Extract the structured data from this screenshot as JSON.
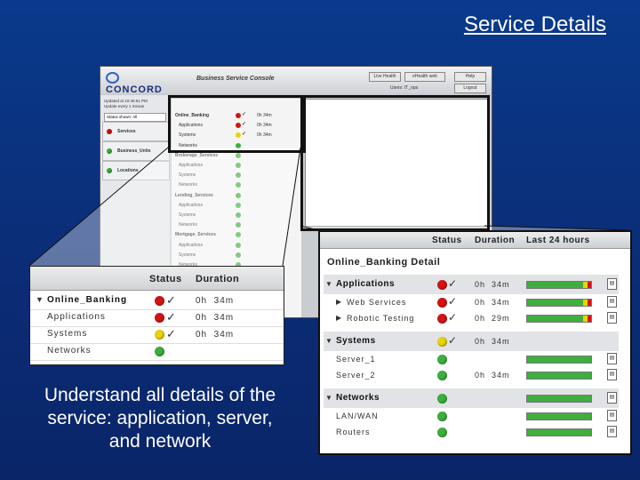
{
  "slide": {
    "title": "Service Details",
    "caption": "Understand all details of the service: application, server, and network"
  },
  "console": {
    "logo_text": "CONCORD",
    "app_title": "Business Service Console",
    "top_buttons": [
      "Live Health",
      "eHealth web",
      "Help"
    ],
    "user_label": "Users: IT_ops",
    "logout_label": "Logout",
    "side_info": [
      "Updated at 10:46:51 PM",
      "Update every 1 minute"
    ],
    "status_select": "Status shown: All",
    "side_items": [
      {
        "label": "Services",
        "status": "red"
      },
      {
        "label": "Business_Units",
        "status": "green"
      },
      {
        "label": "Locations",
        "status": "green"
      }
    ],
    "tree": [
      {
        "label": "Online_Banking",
        "head": true,
        "status": "red",
        "check": true,
        "duration": "0h 34m"
      },
      {
        "label": "Applications",
        "status": "red",
        "check": true,
        "duration": "0h 34m"
      },
      {
        "label": "Systems",
        "status": "yellow",
        "check": true,
        "duration": "0h 34m"
      },
      {
        "label": "Networks",
        "status": "green",
        "check": false,
        "duration": ""
      },
      {
        "label": "Brokerage_Services",
        "head": true,
        "status": "green",
        "check": false,
        "duration": ""
      },
      {
        "label": "Applications",
        "status": "green",
        "check": false,
        "duration": ""
      },
      {
        "label": "Systems",
        "status": "green",
        "check": false,
        "duration": ""
      },
      {
        "label": "Networks",
        "status": "green",
        "check": false,
        "duration": ""
      },
      {
        "label": "Lending_Services",
        "head": true,
        "status": "green",
        "check": false,
        "duration": ""
      },
      {
        "label": "Applications",
        "status": "green",
        "check": false,
        "duration": ""
      },
      {
        "label": "Systems",
        "status": "green",
        "check": false,
        "duration": ""
      },
      {
        "label": "Networks",
        "status": "green",
        "check": false,
        "duration": ""
      },
      {
        "label": "Mortgage_Services",
        "head": true,
        "status": "green",
        "check": false,
        "duration": ""
      },
      {
        "label": "Applications",
        "status": "green",
        "check": false,
        "duration": ""
      },
      {
        "label": "Systems",
        "status": "green",
        "check": false,
        "duration": ""
      },
      {
        "label": "Networks",
        "status": "green",
        "check": false,
        "duration": ""
      }
    ]
  },
  "left_zoom": {
    "col_status": "Status",
    "col_duration": "Duration",
    "rows": [
      {
        "label": "Online_Banking",
        "head": true,
        "status": "red",
        "check": true,
        "duration": "0h  34m"
      },
      {
        "label": "Applications",
        "status": "red",
        "check": true,
        "duration": "0h  34m"
      },
      {
        "label": "Systems",
        "status": "yellow",
        "check": true,
        "duration": "0h  34m"
      },
      {
        "label": "Networks",
        "status": "green",
        "check": false,
        "duration": ""
      }
    ]
  },
  "right_zoom": {
    "col_status": "Status",
    "col_duration": "Duration",
    "col_last24": "Last 24 hours",
    "detail_title": "Online_Banking Detail",
    "sections": [
      {
        "label": "Applications",
        "status": "red",
        "check": true,
        "duration": "0h  34m",
        "bar": "error",
        "items": [
          {
            "label": "Web Services",
            "expand": true,
            "status": "red",
            "check": true,
            "duration": "0h  34m",
            "bar": "error"
          },
          {
            "label": "Robotic Testing",
            "expand": true,
            "status": "red",
            "check": true,
            "duration": "0h  29m",
            "bar": "error"
          }
        ]
      },
      {
        "label": "Systems",
        "status": "yellow",
        "check": true,
        "duration": "0h  34m",
        "bar": "none",
        "items": [
          {
            "label": "Server_1",
            "status": "green",
            "check": false,
            "duration": "",
            "bar": "ok"
          },
          {
            "label": "Server_2",
            "status": "green",
            "check": false,
            "duration": "0h  34m",
            "bar": "ok"
          }
        ]
      },
      {
        "label": "Networks",
        "status": "green",
        "check": false,
        "duration": "",
        "bar": "ok",
        "items": [
          {
            "label": "LAN/WAN",
            "status": "green",
            "check": false,
            "duration": "",
            "bar": "ok"
          },
          {
            "label": "Routers",
            "status": "green",
            "check": false,
            "duration": "",
            "bar": "ok"
          }
        ]
      }
    ]
  },
  "colors": {
    "background": "#0b2f7a",
    "red": "#d41414",
    "yellow": "#e8d400",
    "green": "#3bb03b"
  },
  "icons": {
    "expand": "triangle-down-icon",
    "sub_expand": "triangle-right-icon",
    "check": "checkmark-icon",
    "report": "report-icon"
  }
}
